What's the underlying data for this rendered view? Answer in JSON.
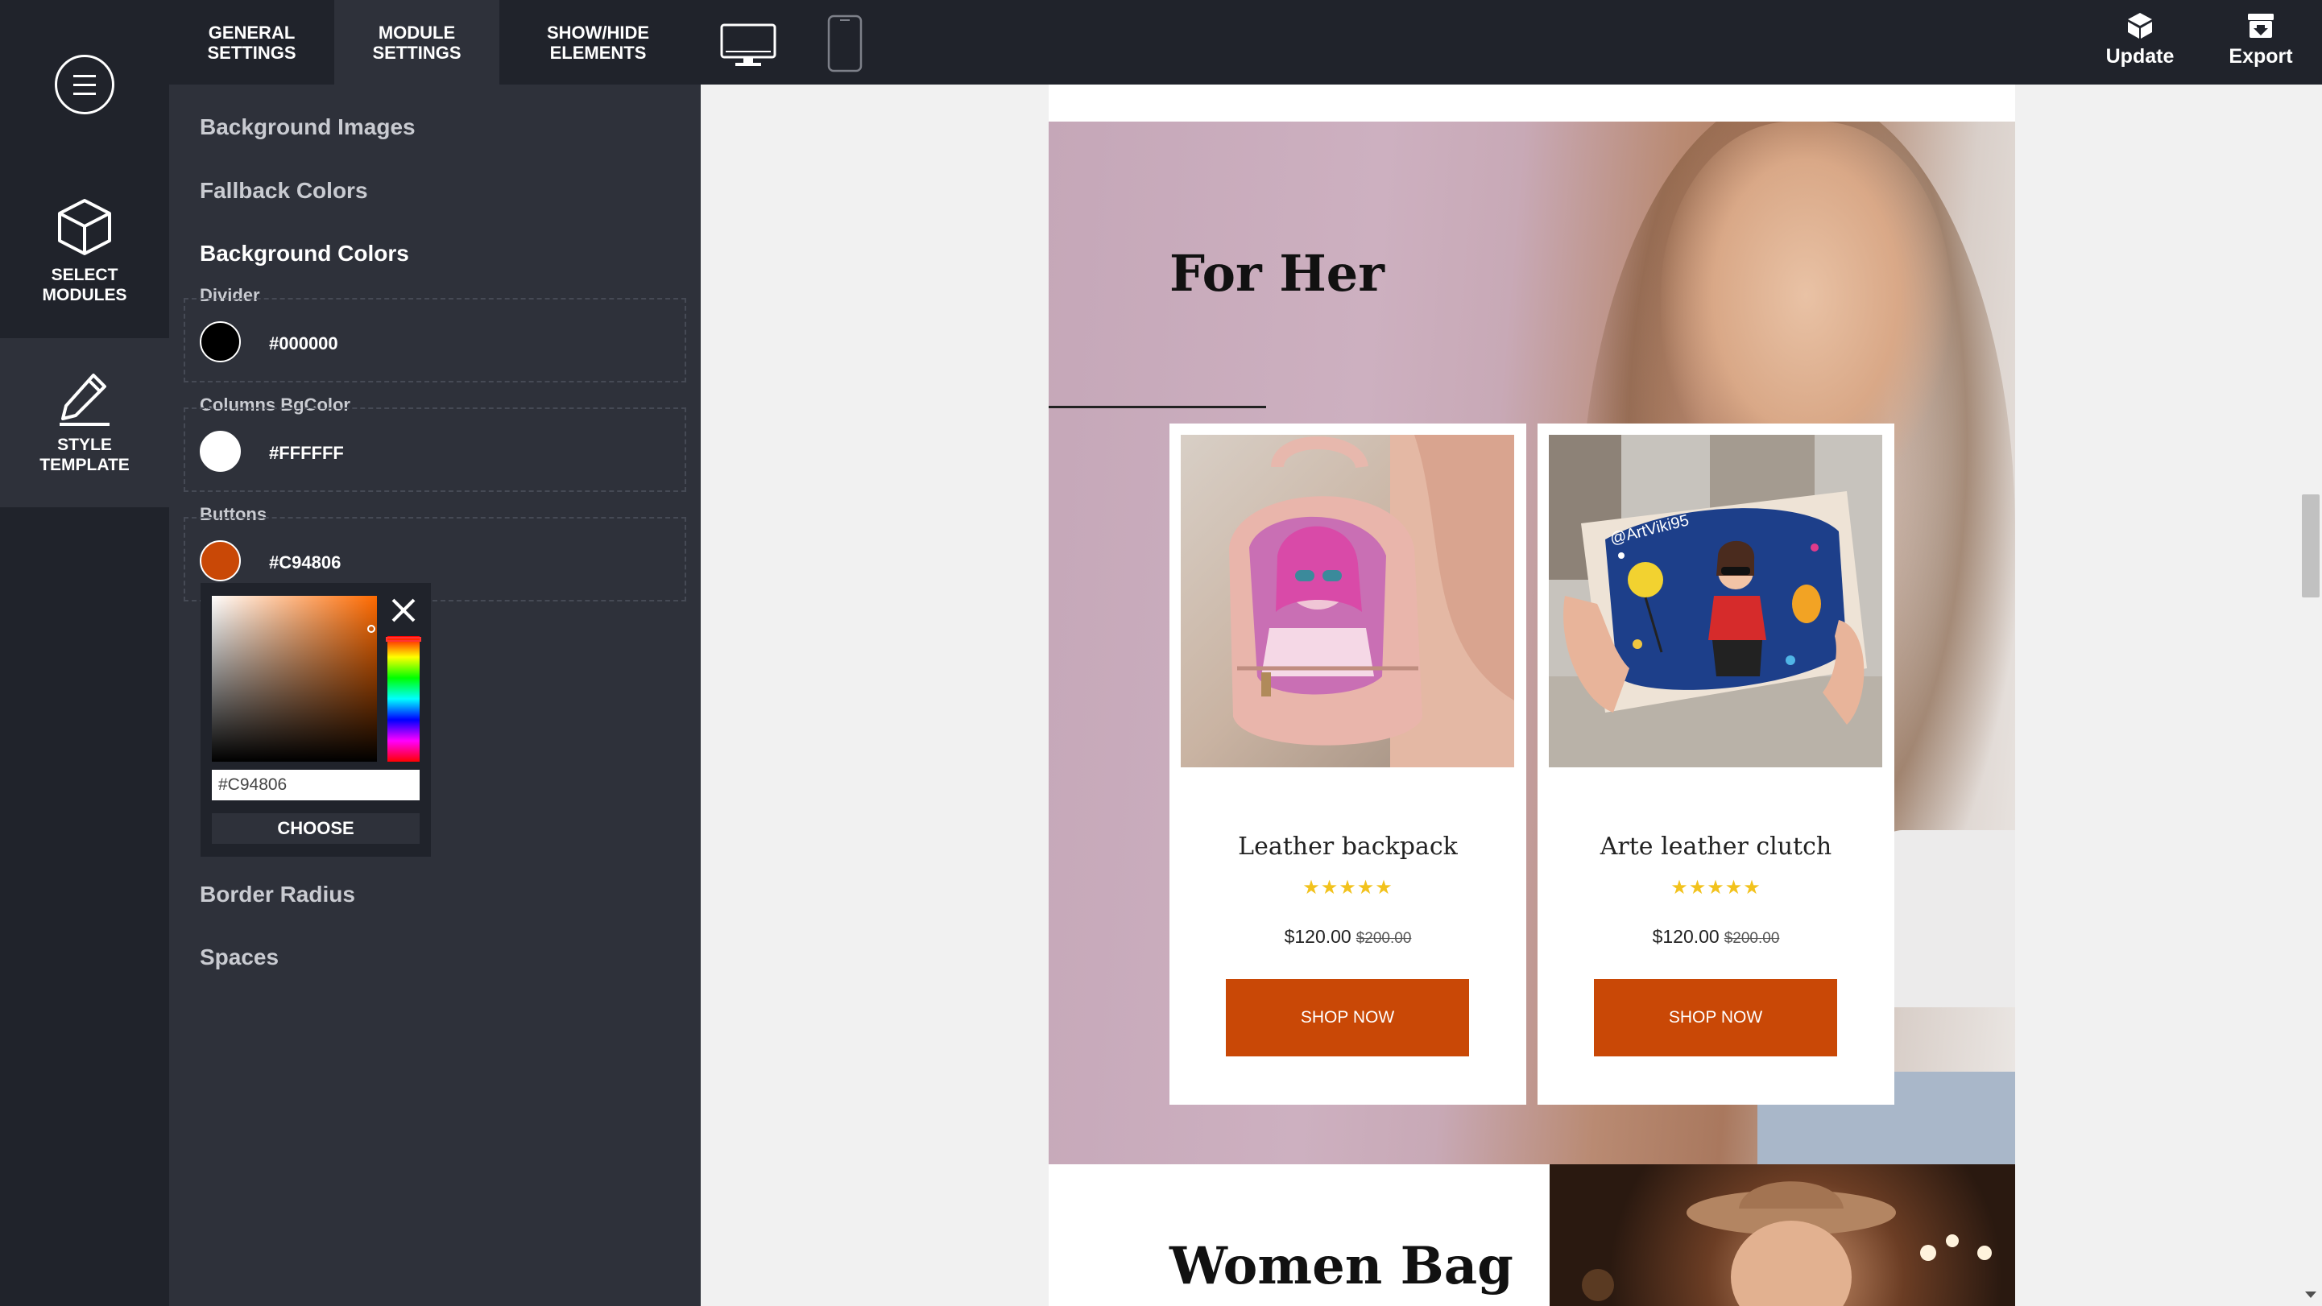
{
  "topbar": {
    "tabs": [
      {
        "label_line1": "GENERAL",
        "label_line2": "SETTINGS"
      },
      {
        "label_line1": "MODULE",
        "label_line2": "SETTINGS"
      },
      {
        "label_line1": "SHOW/HIDE",
        "label_line2": "ELEMENTS"
      }
    ],
    "active_tab": "MODULE SETTINGS",
    "devices": [
      "desktop-icon",
      "mobile-icon"
    ],
    "update_label": "Update",
    "export_label": "Export"
  },
  "rail": {
    "items": [
      {
        "line1": "SELECT",
        "line2": "MODULES",
        "icon": "cube-icon"
      },
      {
        "line1": "STYLE",
        "line2": "TEMPLATE",
        "icon": "pencil-icon"
      }
    ],
    "active": "STYLE TEMPLATE"
  },
  "panel": {
    "sections": {
      "background_images": "Background Images",
      "fallback_colors": "Fallback Colors",
      "background_colors": "Background Colors",
      "border_radius": "Border Radius",
      "spaces": "Spaces"
    },
    "colors": [
      {
        "label": "Divider",
        "value": "#000000",
        "swatch": "#000000"
      },
      {
        "label": "Columns BgColor",
        "value": "#FFFFFF",
        "swatch": "#FFFFFF"
      },
      {
        "label": "Buttons",
        "value": "#C94806",
        "swatch": "#C94806"
      }
    ],
    "picker": {
      "hex_value": "#C94806",
      "choose_label": "CHOOSE"
    }
  },
  "preview": {
    "section1_title": "For Her",
    "products": [
      {
        "name": "Leather backpack",
        "stars": "★★★★★",
        "price": "$120.00",
        "old_price": "$200.00",
        "button": "SHOP NOW"
      },
      {
        "name": "Arte leather clutch",
        "stars": "★★★★★",
        "price": "$120.00",
        "old_price": "$200.00",
        "button": "SHOP NOW"
      }
    ],
    "photo2_tag": "@ArtViki95",
    "section2_title": "Women Bag"
  },
  "colors": {
    "topbar": "#20232b",
    "panel": "#2e313a",
    "accent": "#C94806",
    "stars": "#f2c21c"
  }
}
